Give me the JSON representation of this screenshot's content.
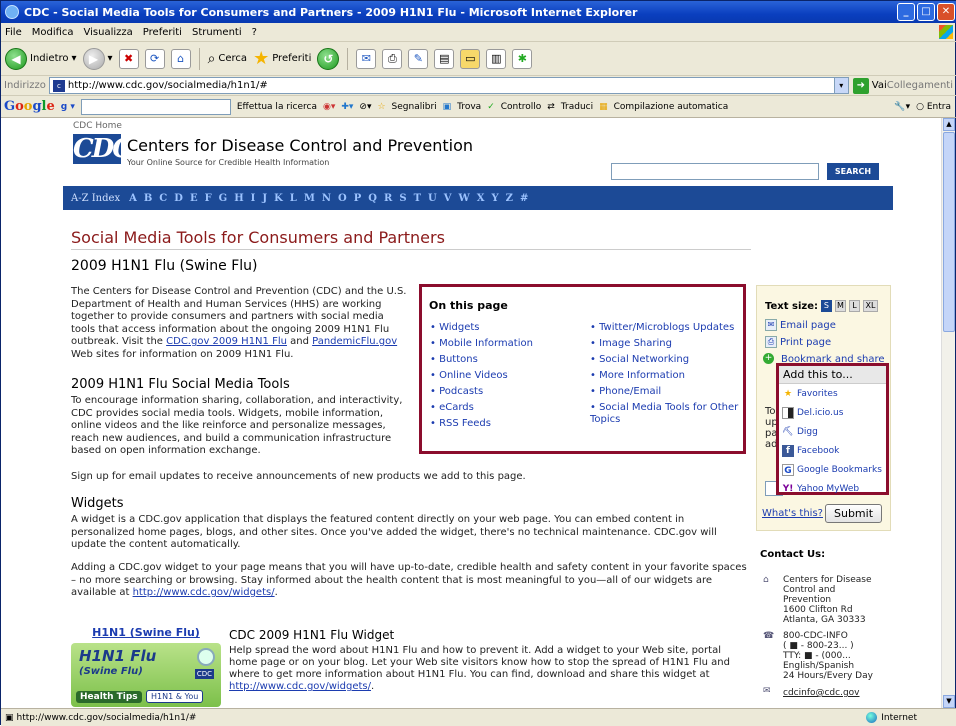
{
  "window": {
    "title": "CDC - Social Media Tools for Consumers and Partners - 2009 H1N1 Flu - Microsoft Internet Explorer"
  },
  "menu": [
    "File",
    "Modifica",
    "Visualizza",
    "Preferiti",
    "Strumenti",
    "?"
  ],
  "toolbar": {
    "back": "Indietro",
    "search": "Cerca",
    "favorites": "Preferiti"
  },
  "address": {
    "label": "Indirizzo",
    "url": "http://www.cdc.gov/socialmedia/h1n1/#",
    "go": "Vai",
    "links": "Collegamenti"
  },
  "googlebar": {
    "logo": "Google",
    "search_btn": "Effettua la ricerca",
    "bookmarks": "Segnalibri",
    "find": "Trova",
    "check": "Controllo",
    "translate": "Traduci",
    "autofill": "Compilazione automatica",
    "signin": "Entra"
  },
  "header": {
    "home": "CDC Home",
    "logo": "CDC",
    "title": "Centers for Disease Control and Prevention",
    "subtitle": "Your Online Source for Credible Health Information",
    "search_btn": "SEARCH"
  },
  "az": {
    "label": "A-Z Index",
    "letters": [
      "A",
      "B",
      "C",
      "D",
      "E",
      "F",
      "G",
      "H",
      "I",
      "J",
      "K",
      "L",
      "M",
      "N",
      "O",
      "P",
      "Q",
      "R",
      "S",
      "T",
      "U",
      "V",
      "W",
      "X",
      "Y",
      "Z",
      "#"
    ]
  },
  "main": {
    "title": "Social Media Tools for Consumers and Partners",
    "subtitle": "2009 H1N1 Flu (Swine Flu)",
    "intro_1": "The Centers for Disease Control and Prevention (CDC) and the U.S. Department of Health and Human Services (HHS) are working together to provide consumers and partners with social media tools that access information about the ongoing 2009 H1N1 Flu outbreak. Visit the",
    "intro_link1": "CDC.gov 2009 H1N1 Flu",
    "intro_and": " and ",
    "intro_link2": "PandemicFlu.gov",
    "intro_2": " Web sites for information on 2009 H1N1 Flu.",
    "tools_heading": "2009 H1N1 Flu Social Media Tools",
    "tools_text": "To encourage information sharing, collaboration, and interactivity, CDC provides social media tools. Widgets, mobile information, online videos and the like reinforce and personalize messages, reach new audiences, and build a communication infrastructure based on open information exchange.",
    "signup": "Sign up for email updates to receive announcements of new products we add to this page.",
    "widgets_heading": "Widgets",
    "widgets_text": "A widget is a CDC.gov application that displays the featured content directly on your web page. You can embed content in personalized home pages, blogs, and other sites. Once you've added the widget, there's no technical maintenance. CDC.gov will update the content automatically.",
    "widgets_text2": "Adding a CDC.gov widget to your page means that you will have up-to-date, credible health and safety content in your favorite spaces – no more searching or browsing. Stay informed about the health content that is most meaningful to you—all of our widgets are available at",
    "widgets_link": "http://www.cdc.gov/widgets/",
    "widgets_end": "."
  },
  "onpage": {
    "title": "On this page",
    "col1": [
      "Widgets",
      "Mobile Information",
      "Buttons",
      "Online Videos",
      "Podcasts",
      "eCards",
      "RSS Feeds"
    ],
    "col2": [
      "Twitter/Microblogs Updates",
      "Image Sharing",
      "Social Networking",
      "More Information",
      "Phone/Email",
      "Social Media Tools for Other Topics"
    ]
  },
  "sidebar": {
    "textsize": "Text size:",
    "sizes": [
      "S",
      "M",
      "L",
      "XL"
    ],
    "email": "Email page",
    "print": "Print page",
    "bookmark": "Bookmark and share",
    "whatsthis": "What's this?",
    "submit": "Submit",
    "partial": [
      "To",
      "up",
      "pa",
      "ad"
    ]
  },
  "bookmark_panel": {
    "header": "Add this to...",
    "items": [
      "Favorites",
      "Del.icio.us",
      "Digg",
      "Facebook",
      "Google Bookmarks",
      "Yahoo MyWeb"
    ]
  },
  "contact": {
    "title": "Contact Us:",
    "address": [
      "Centers for Disease",
      "Control and",
      "Prevention",
      "1600 Clifton Rd",
      "Atlanta, GA 30333"
    ],
    "phone": [
      "800-CDC-INFO",
      "( ■ - 800-23... )",
      "TTY: ■ - (000...",
      "English/Spanish",
      "24 Hours/Every Day"
    ],
    "email": "cdcinfo@cdc.gov"
  },
  "widget": {
    "title": "H1N1 (Swine Flu)",
    "img_title": "H1N1 Flu",
    "img_sub": "(Swine Flu)",
    "pill1": "Health Tips",
    "pill2": "H1N1 & You",
    "cdc": "CDC",
    "heading": "CDC 2009 H1N1 Flu Widget",
    "desc": "Help spread the word about H1N1 Flu and how to prevent it. Add a widget to your Web site, portal home page or on your blog. Let your Web site visitors know how to stop the spread of H1N1 Flu and where to get more information about H1N1 Flu. You can find, download and share this widget at",
    "desc_link": "http://www.cdc.gov/widgets/",
    "desc_end": "."
  },
  "status": {
    "url": "http://www.cdc.gov/socialmedia/h1n1/#",
    "zone": "Internet"
  }
}
